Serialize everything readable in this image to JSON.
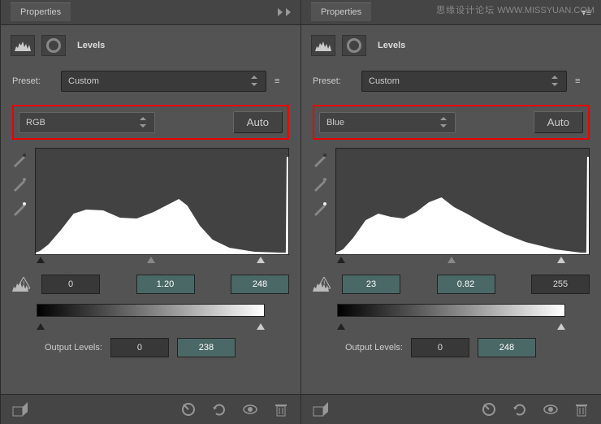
{
  "watermark": {
    "a": "思缘设计论坛",
    "b": "WWW.MISSYUAN.COM"
  },
  "panels": [
    {
      "header_tab": "Properties",
      "title": "Levels",
      "preset_label": "Preset:",
      "preset_value": "Custom",
      "channel_value": "RGB",
      "auto_label": "Auto",
      "input_black": "0",
      "input_gamma": "1.20",
      "input_white": "248",
      "output_label": "Output Levels:",
      "output_black": "0",
      "output_white": "238"
    },
    {
      "header_tab": "Properties",
      "title": "Levels",
      "preset_label": "Preset:",
      "preset_value": "Custom",
      "channel_value": "Blue",
      "auto_label": "Auto",
      "input_black": "23",
      "input_gamma": "0.82",
      "input_white": "255",
      "output_label": "Output Levels:",
      "output_black": "0",
      "output_white": "248"
    }
  ],
  "chart_data": [
    {
      "type": "area",
      "title": "RGB histogram",
      "xlabel": "",
      "ylabel": "",
      "values": [
        2,
        3,
        4,
        6,
        10,
        16,
        24,
        32,
        40,
        46,
        50,
        52,
        52,
        50,
        48,
        46,
        44,
        42,
        40,
        38,
        36,
        35,
        34,
        34,
        35,
        36,
        38,
        40,
        44,
        50,
        56,
        50,
        40,
        30,
        22,
        16,
        12,
        8,
        6,
        4,
        3,
        2,
        2,
        1,
        1,
        1,
        1,
        1,
        1,
        1,
        1,
        1,
        1,
        1,
        1,
        1,
        1,
        1,
        1,
        1,
        90
      ],
      "xlim": [
        0,
        255
      ]
    },
    {
      "type": "area",
      "title": "Blue histogram",
      "xlabel": "",
      "ylabel": "",
      "values": [
        1,
        2,
        4,
        8,
        14,
        20,
        28,
        36,
        42,
        46,
        48,
        46,
        44,
        42,
        40,
        38,
        38,
        40,
        44,
        50,
        56,
        62,
        64,
        60,
        54,
        48,
        44,
        40,
        38,
        36,
        34,
        32,
        30,
        28,
        26,
        24,
        22,
        20,
        18,
        16,
        14,
        12,
        10,
        8,
        6,
        5,
        4,
        3,
        2,
        2,
        1,
        1,
        1,
        1,
        1,
        1,
        1,
        1,
        1,
        1,
        90
      ],
      "xlim": [
        0,
        255
      ]
    }
  ]
}
